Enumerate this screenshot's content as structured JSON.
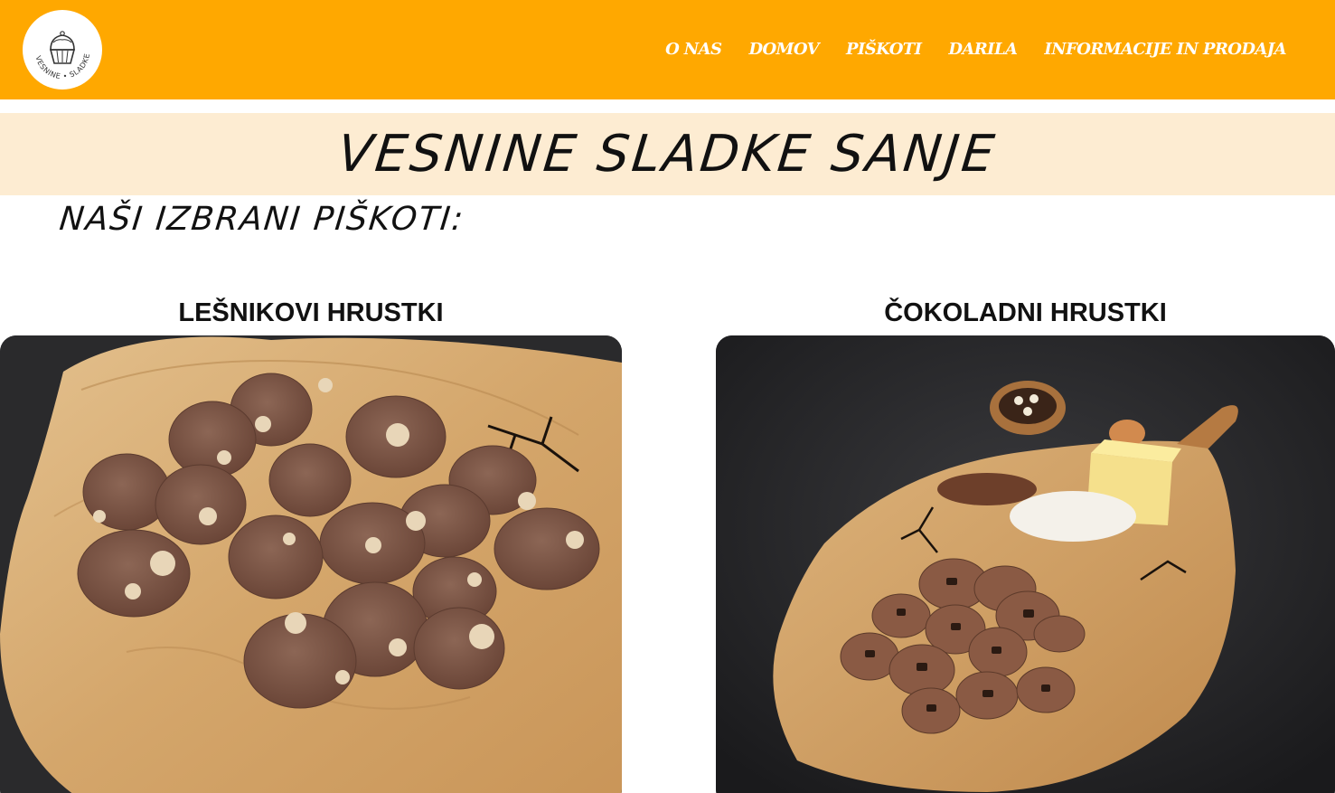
{
  "header": {
    "logo": {
      "text": "VESNINE • SLADKE • SANJE",
      "icon": "cupcake-icon"
    },
    "nav": [
      {
        "label": "O NAS"
      },
      {
        "label": "DOMOV"
      },
      {
        "label": "PIŠKOTI"
      },
      {
        "label": "DARILA"
      },
      {
        "label": "INFORMACIJE IN PRODAJA"
      }
    ]
  },
  "title": "VESNINE SLADKE SANJE",
  "section_heading": "NAŠI IZBRANI PIŠKOTI:",
  "products": [
    {
      "name": "LEŠNIKOVI HRUSTKI",
      "image": "hazelnut-cookies-on-wood-board"
    },
    {
      "name": "ČOKOLADNI HRUSTKI",
      "image": "chocolate-cookies-with-ingredients-on-wood-board"
    }
  ],
  "colors": {
    "header_bg": "#ffa800",
    "title_band_bg": "#fdecd2",
    "text": "#111111",
    "nav_text": "#ffffff"
  }
}
